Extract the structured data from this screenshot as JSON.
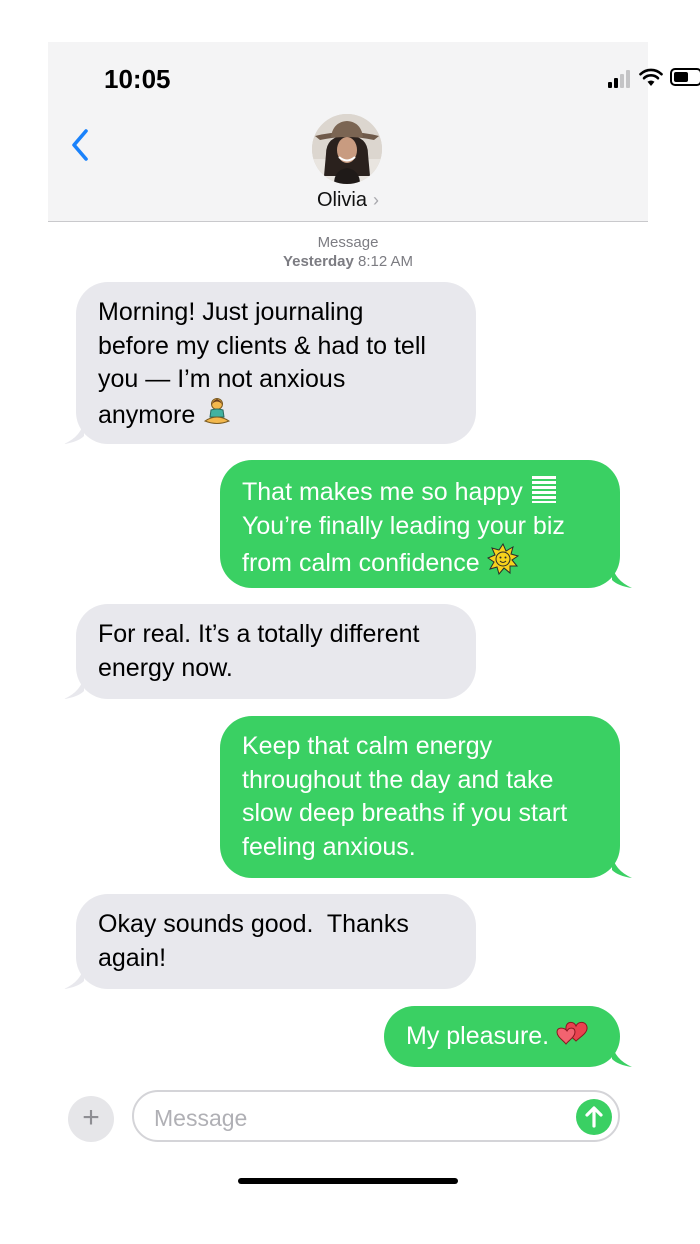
{
  "status_bar": {
    "time": "10:05"
  },
  "header": {
    "contact_name": "Olivia",
    "name_chevron": "›"
  },
  "thread_meta": {
    "service": "Message",
    "day": "Yesterday",
    "time": "8:12 AM"
  },
  "messages": [
    {
      "sender": "contact",
      "lines": [
        "Morning! Just journaling",
        "before my clients & had to tell",
        "you — I’m not anxious",
        "anymore"
      ],
      "emoji": "meditating-woman-icon"
    },
    {
      "sender": "me",
      "lines": [
        "That makes me so happy",
        "You’re finally leading your biz",
        "from calm confidence"
      ],
      "emoji": [
        "raising-hands-icon",
        "sun-icon"
      ]
    },
    {
      "sender": "contact",
      "lines": [
        "For real. It’s a totally different",
        "energy now."
      ]
    },
    {
      "sender": "me",
      "lines": [
        "Keep that calm energy",
        "throughout the day and take",
        "slow deep breaths if you start",
        "feeling anxious."
      ]
    },
    {
      "sender": "contact",
      "lines": [
        "Okay sounds good.  Thanks",
        "again!"
      ]
    },
    {
      "sender": "me",
      "lines": [
        "My pleasure."
      ],
      "emoji": "two-hearts-icon"
    }
  ],
  "composer": {
    "placeholder": "Message",
    "plus_label": "+"
  },
  "colors": {
    "incoming_bubble": "#e8e8ed",
    "outgoing_bubble": "#3ad063",
    "accent": "#1a82fb"
  }
}
